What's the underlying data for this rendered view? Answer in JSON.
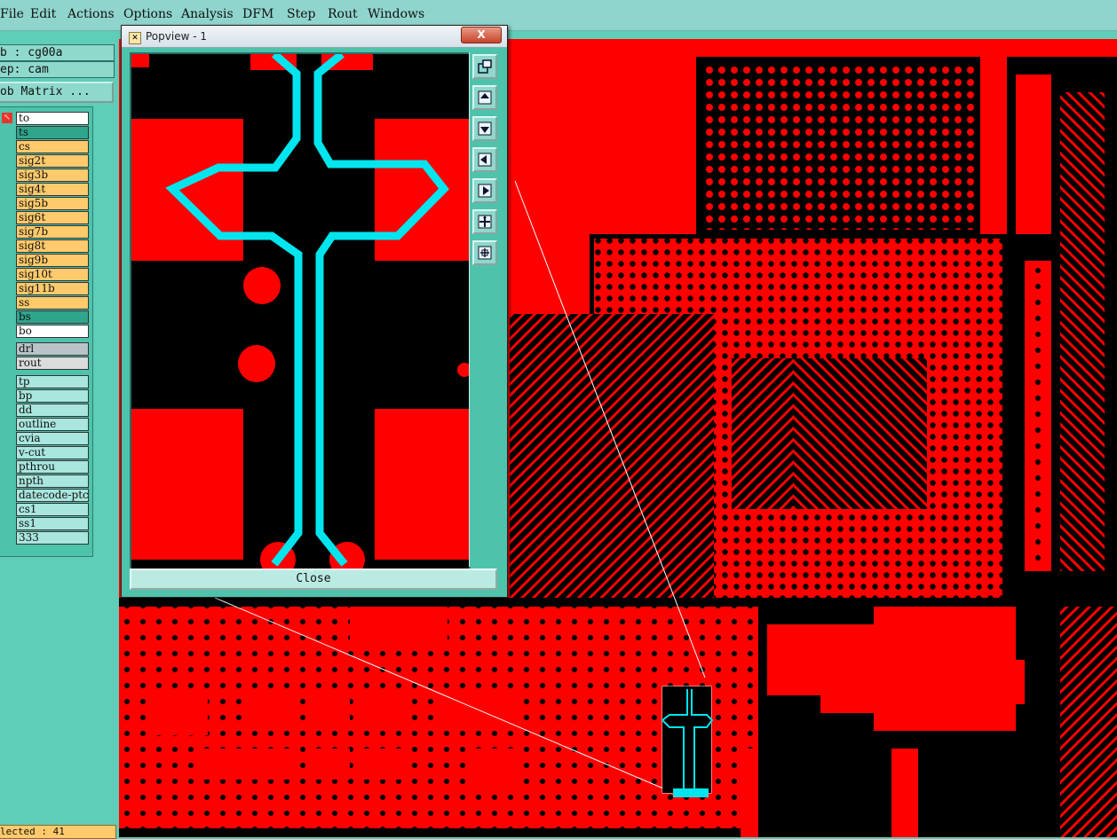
{
  "menu": {
    "items": [
      "File",
      "Edit",
      "Actions",
      "Options",
      "Analysis",
      "DFM",
      "Step",
      "Rout",
      "Windows"
    ]
  },
  "left_panel": {
    "job_label": "b : cg00a",
    "step_label": "ep: cam",
    "matrix_button": "ob Matrix ...",
    "layers": [
      {
        "name": "to",
        "color": "#ffffff"
      },
      {
        "name": "ts",
        "color": "#2fa58c"
      },
      {
        "name": "cs",
        "color": "#ffca6b"
      },
      {
        "name": "sig2t",
        "color": "#ffca6b"
      },
      {
        "name": "sig3b",
        "color": "#ffca6b"
      },
      {
        "name": "sig4t",
        "color": "#ffca6b"
      },
      {
        "name": "sig5b",
        "color": "#ffca6b"
      },
      {
        "name": "sig6t",
        "color": "#ffca6b"
      },
      {
        "name": "sig7b",
        "color": "#ffca6b"
      },
      {
        "name": "sig8t",
        "color": "#ffca6b"
      },
      {
        "name": "sig9b",
        "color": "#ffca6b"
      },
      {
        "name": "sig10t",
        "color": "#ffca6b"
      },
      {
        "name": "sig11b",
        "color": "#ffca6b"
      },
      {
        "name": "ss",
        "color": "#ffca6b"
      },
      {
        "name": "bs",
        "color": "#2fa58c"
      },
      {
        "name": "bo",
        "color": "#ffffff"
      },
      {
        "name": "drl",
        "color": "#b9c4c8"
      },
      {
        "name": "rout",
        "color": "#dcdcdc"
      },
      {
        "name": "tp",
        "color": "#a8e6de"
      },
      {
        "name": "bp",
        "color": "#a8e6de"
      },
      {
        "name": "dd",
        "color": "#a8e6de"
      },
      {
        "name": "outline",
        "color": "#a8e6de"
      },
      {
        "name": "cvia",
        "color": "#a8e6de"
      },
      {
        "name": "v-cut",
        "color": "#a8e6de"
      },
      {
        "name": "pthrou",
        "color": "#a8e6de"
      },
      {
        "name": "npth",
        "color": "#a8e6de"
      },
      {
        "name": "datecode-ptc",
        "color": "#a8e6de"
      },
      {
        "name": "cs1",
        "color": "#a8e6de"
      },
      {
        "name": "ss1",
        "color": "#a8e6de"
      },
      {
        "name": "333",
        "color": "#a8e6de"
      }
    ],
    "status": "lected : 41"
  },
  "popview": {
    "title": "Popview - 1",
    "close_x": "X",
    "close_button": "Close"
  },
  "colors": {
    "board_copper": "#ff0000",
    "board_background": "#000000",
    "highlight_trace": "#00e5ee",
    "panel": "#5fcdb8"
  }
}
